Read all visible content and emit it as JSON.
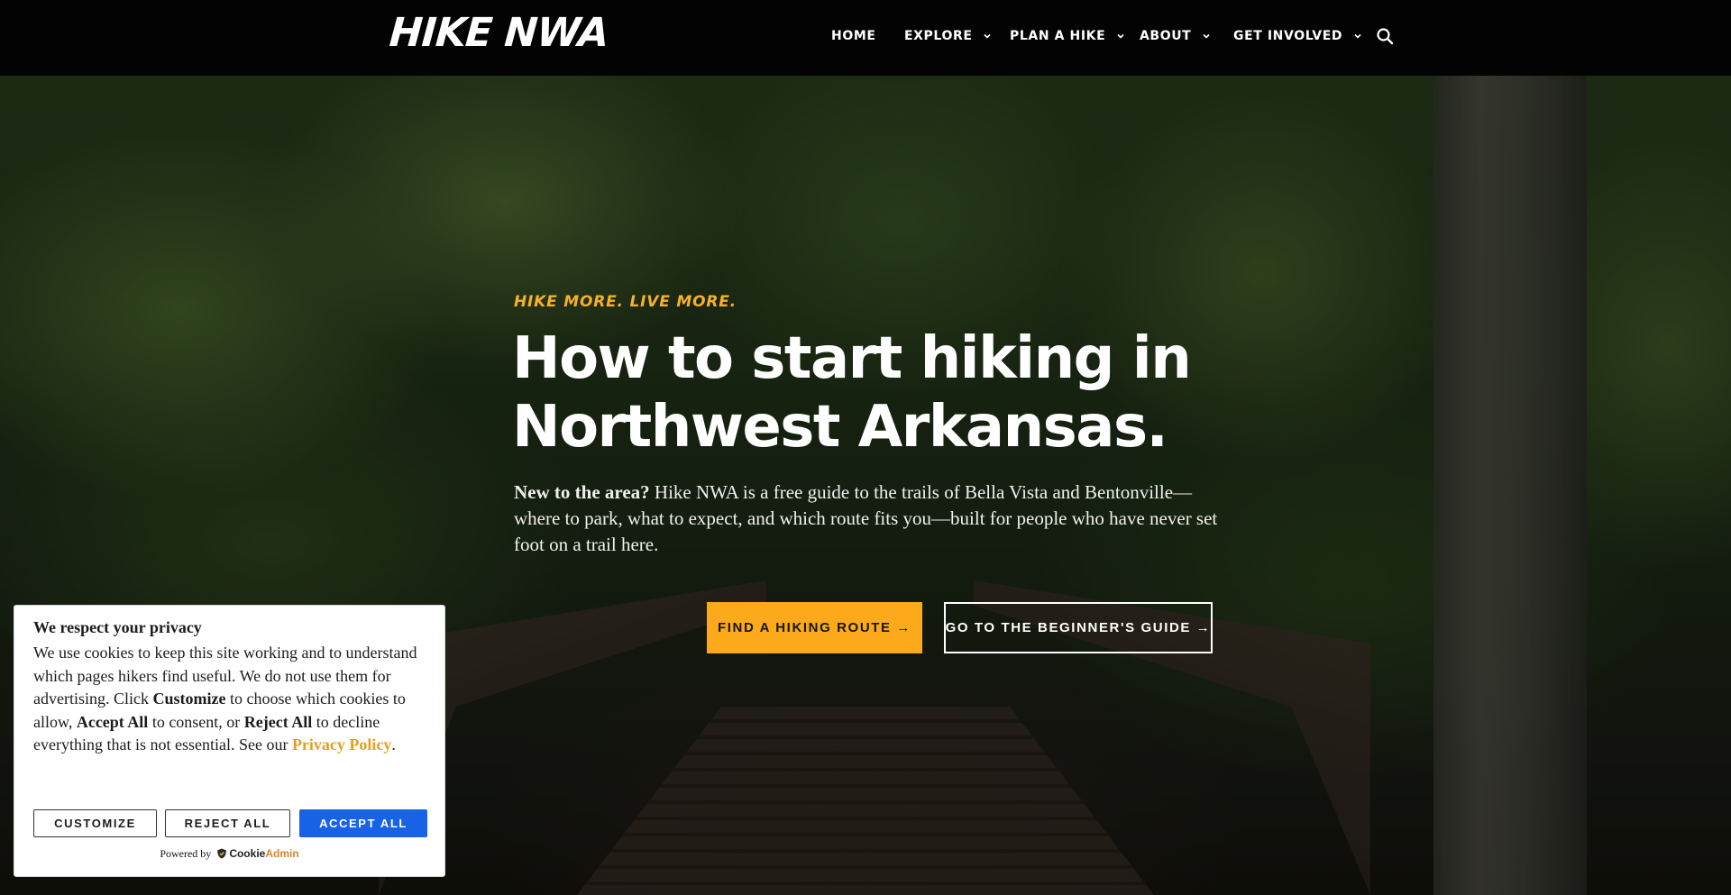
{
  "header": {
    "logo": "HIKE NWA",
    "nav": [
      {
        "label": "HOME",
        "has_dropdown": false
      },
      {
        "label": "EXPLORE",
        "has_dropdown": true
      },
      {
        "label": "PLAN A HIKE",
        "has_dropdown": true
      },
      {
        "label": "ABOUT",
        "has_dropdown": true
      },
      {
        "label": "GET INVOLVED",
        "has_dropdown": true
      }
    ],
    "search_icon": "search-icon"
  },
  "hero": {
    "eyebrow": "HIKE MORE. LIVE MORE.",
    "title_line1": "How to start hiking in",
    "title_line2": "Northwest Arkansas.",
    "intro_lead": "New to the area?",
    "intro_rest": " Hike NWA is a free guide to the trails of Bella Vista and Bentonville—where to park, what to expect, and which route fits you—built for people who have never set foot on a trail here.",
    "primary_button": "FIND A HIKING ROUTE →",
    "secondary_button": "GO TO THE BEGINNER'S GUIDE →"
  },
  "cookie_banner": {
    "title": "We respect your privacy",
    "body_1": "We use cookies to keep this site working and to understand which pages hikers find useful. We do not use them for advertising. Click ",
    "body_customize": "Customize",
    "body_2": " to choose which cookies to allow, ",
    "body_accept": "Accept All",
    "body_3": " to consent, or ",
    "body_reject": "Reject All",
    "body_4": " to decline everything that is not essential. See our ",
    "privacy_link": "Privacy Policy",
    "body_5": ".",
    "customize_button": "CUSTOMIZE",
    "reject_button": "REJECT ALL",
    "accept_button": "ACCEPT ALL",
    "powered_by": "Powered by",
    "brand_cookie": "Cookie",
    "brand_admin": "Admin"
  },
  "colors": {
    "accent": "#fcaa1b",
    "eyebrow": "#f5b12a",
    "header_bg": "#030303",
    "accept_blue": "#1862e6"
  }
}
